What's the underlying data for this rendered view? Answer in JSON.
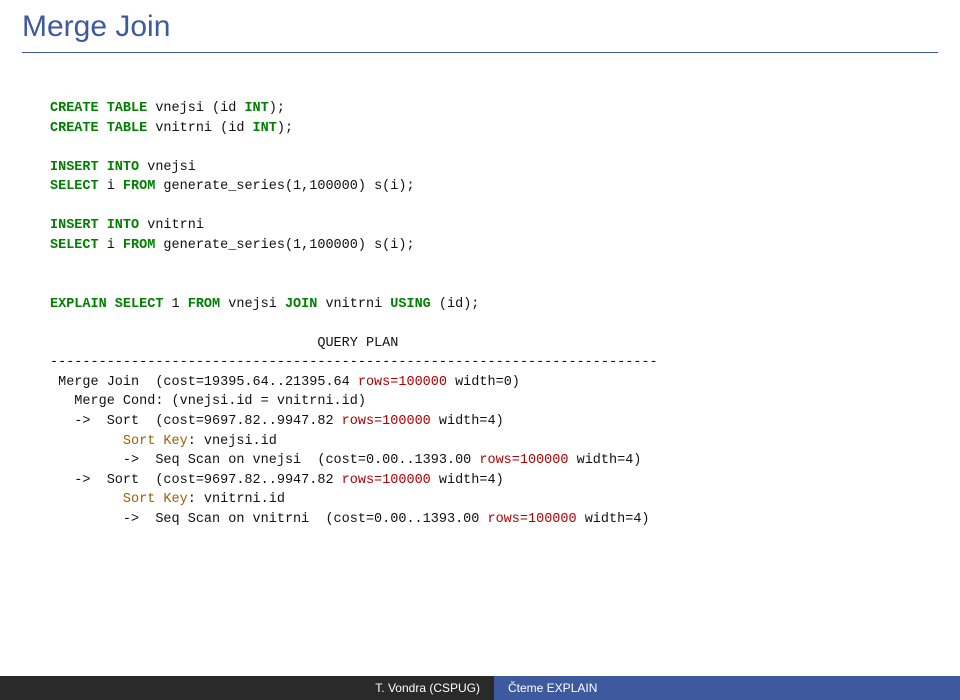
{
  "title": "Merge Join",
  "sql": {
    "create1_pre": "CREATE TABLE",
    "create1_rest": " vnejsi (id ",
    "int": "INT",
    "close": ");",
    "create2_rest": " vnitrni (id ",
    "insert": "INSERT INTO",
    "ins1_rest": " vnejsi",
    "select": "SELECT",
    "from": "FROM",
    "sel1_i": " i ",
    "gen1_rest": " generate_series(1,100000) s(i);",
    "ins2_rest": " vnitrni",
    "explain": "EXPLAIN SELECT",
    "exp_1": " 1 ",
    "join": "JOIN",
    "using": "USING",
    "exp_rest1": " vnejsi ",
    "exp_rest2": " vnitrni ",
    "exp_rest3": " (id);"
  },
  "plan": {
    "header": "                                 QUERY PLAN",
    "sep": "---------------------------------------------------------------------------",
    "l1a": " Merge Join  (cost=19395.64..21395.64 ",
    "l1rows": "rows=100000",
    "l1b": " width=0)",
    "l2a": "   Merge Cond: (vnejsi.id = vnitrni.id)",
    "l3a": "   ->  Sort  (cost=9697.82..9947.82 ",
    "l3rows": "rows=100000",
    "l3b": " width=4)",
    "l4key": "         Sort Key",
    "l4rest": ": vnejsi.id",
    "l5a": "         ->  Seq Scan on vnejsi  (cost=0.00..1393.00 ",
    "l5rows": "rows=100000",
    "l5b": " width=4)",
    "l6a": "   ->  Sort  (cost=9697.82..9947.82 ",
    "l6rows": "rows=100000",
    "l6b": " width=4)",
    "l7key": "         Sort Key",
    "l7rest": ": vnitrni.id",
    "l8a": "         ->  Seq Scan on vnitrni  (cost=0.00..1393.00 ",
    "l8rows": "rows=100000",
    "l8b": " width=4)"
  },
  "footer": {
    "left": "T. Vondra (CSPUG)",
    "right": "Čteme EXPLAIN"
  }
}
